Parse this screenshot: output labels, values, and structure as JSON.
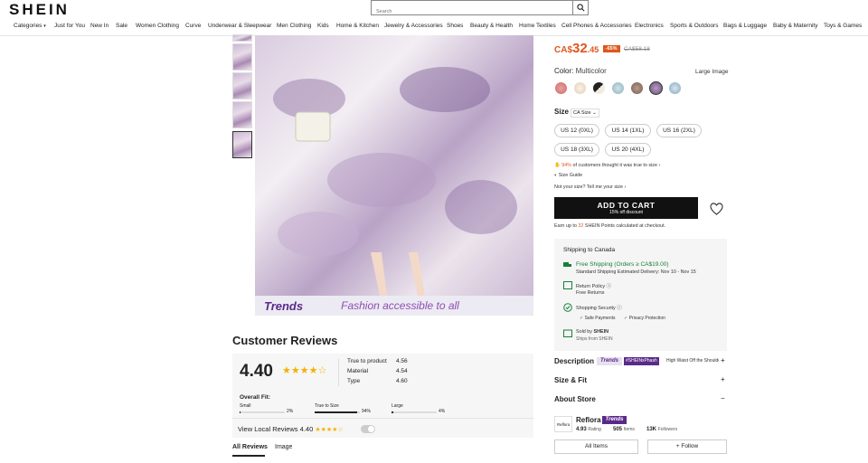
{
  "header": {
    "logo": "SHEIN",
    "search_placeholder": "Search",
    "nav": [
      "Categories",
      "Just for You",
      "New In",
      "Sale",
      "Women Clothing",
      "Curve",
      "Underwear & Sleepwear",
      "Men Clothing",
      "Kids",
      "Home & Kitchen",
      "Jewelry & Accessories",
      "Shoes",
      "Beauty & Health",
      "Home Textiles",
      "Cell Phones & Accessories",
      "Electronics",
      "Sports & Outdoors",
      "Bags & Luggage",
      "Baby & Maternity",
      "Toys & Games"
    ]
  },
  "gallery": {
    "banner_brand": "Trends",
    "banner_tagline": "Fashion accessible to all",
    "selected_thumb_index": 4
  },
  "product": {
    "price_currency": "CA$",
    "price_main": "32",
    "price_cents": ".45",
    "discount": "-65%",
    "original_price": "CA$58.18",
    "color_label": "Color:",
    "color_value": "Multicolor",
    "large_image": "Large Image",
    "size_label": "Size",
    "size_system": "CA Size",
    "sizes": [
      "US 12 (0XL)",
      "US 14 (1XL)",
      "US 16 (2XL)",
      "US 18 (3XL)",
      "US 20 (4XL)"
    ],
    "fit_percent": "94%",
    "fit_text": "of customers thought it was true to size",
    "size_guide": "Size Guide",
    "not_your_size": "Not your size? Tell me your size",
    "add_to_cart": "ADD TO CART",
    "add_to_cart_sub": "15% off discount",
    "points_prefix": "Earn up to",
    "points_value": "32",
    "points_suffix": "SHEIN Points calculated at checkout."
  },
  "shipping": {
    "title": "Shipping to",
    "country": "Canada",
    "free_shipping": "Free Shipping (Orders ≥ CA$19.00)",
    "standard": "Standard Shipping Estimated Delivery: Nov 10 - Nov 15",
    "return_policy": "Return Policy",
    "free_returns": "Free Returns",
    "shopping_security": "Shopping Security",
    "safe_payments": "Safe Payments",
    "privacy": "Privacy Protection",
    "sold_by_label": "Sold by",
    "sold_by": "SHEIN",
    "ships_from": "Ships from SHEIN"
  },
  "description": {
    "label": "Description",
    "tags": [
      "Trends",
      "#SHEINxPhash"
    ],
    "snippet": "High Waist Off the Shoulder..."
  },
  "size_fit": "Size & Fit",
  "about_store": "About Store",
  "store": {
    "logo_text": "Reflora",
    "name": "Reflora",
    "badge": "Trends",
    "rating_value": "4.93",
    "rating_label": "Rating",
    "items_value": "505",
    "items_label": "Items",
    "followers_value": "13K",
    "followers_label": "Followers",
    "all_items": "All Items",
    "follow": "+ Follow"
  },
  "reviews": {
    "title": "Customer Reviews",
    "rating": "4.40",
    "stars_rating": 4.4,
    "metrics": [
      {
        "label": "True to product",
        "value": "4.56"
      },
      {
        "label": "Material",
        "value": "4.54"
      },
      {
        "label": "Type",
        "value": "4.60"
      }
    ],
    "overall_fit_label": "Overall Fit:",
    "fit": [
      {
        "label": "Small",
        "pct": "2%",
        "frac": 0.02
      },
      {
        "label": "True to Size",
        "pct": "94%",
        "frac": 0.94
      },
      {
        "label": "Large",
        "pct": "4%",
        "frac": 0.04
      }
    ],
    "local_reviews": "View Local Reviews",
    "local_rating": "4.40",
    "tabs": [
      "All Reviews",
      "Image"
    ]
  }
}
